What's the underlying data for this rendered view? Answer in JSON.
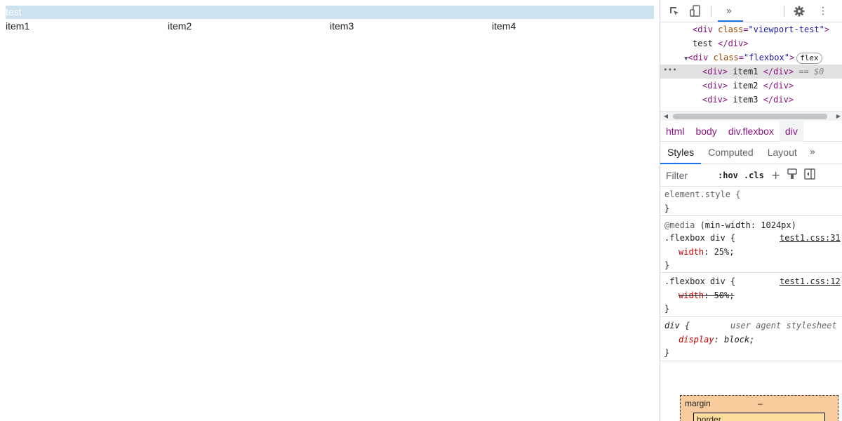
{
  "page": {
    "viewport_test_text": "test",
    "flex_items": [
      "item1",
      "item2",
      "item3",
      "item4"
    ]
  },
  "devtools": {
    "toolbar": {
      "icons": [
        "inspect-icon",
        "device-toggle-icon",
        "more-panels-icon",
        "settings-icon",
        "kebab-menu-icon"
      ]
    },
    "dom": {
      "line1": {
        "tag_open": "<div",
        "attr_name": "class",
        "attr_val": "\"viewport-test\"",
        "tag_close": ">"
      },
      "line2": {
        "text": "test ",
        "tag_end": "</div>"
      },
      "line3": {
        "tag_open": "<div",
        "attr_name": "class",
        "attr_val": "\"flexbox\"",
        "tag_close": ">",
        "badge": "flex"
      },
      "line4": {
        "tag_open": "<div>",
        "text": " item1 ",
        "tag_end": "</div>",
        "suffix": " == $0"
      },
      "line5": {
        "tag_open": "<div>",
        "text": " item2 ",
        "tag_end": "</div>"
      },
      "line6": {
        "tag_open": "<div>",
        "text": " item3 ",
        "tag_end": "</div>"
      }
    },
    "breadcrumb": [
      "html",
      "body",
      "div.flexbox",
      "div"
    ],
    "tabs": [
      "Styles",
      "Computed",
      "Layout"
    ],
    "filter": {
      "placeholder": "Filter",
      "hov": ":hov",
      "cls": ".cls"
    },
    "styles": {
      "element_style": {
        "selector": "element.style {",
        "close": "}"
      },
      "media_rule": {
        "media_keyword": "@media",
        "media_query": " (min-width: 1024px)",
        "selector": ".flexbox div {",
        "source": "test1.css:31",
        "prop": "width",
        "value": "25%;",
        "close": "}"
      },
      "base_rule": {
        "selector": ".flexbox div {",
        "source": "test1.css:12",
        "prop": "width",
        "value": "50%;",
        "close": "}"
      },
      "ua_rule": {
        "selector": "div {",
        "source": "user agent stylesheet",
        "prop": "display",
        "value": "block;",
        "close": "}"
      }
    },
    "box_model": {
      "margin_label": "margin",
      "margin_value": "–",
      "border_label": "border"
    }
  },
  "colors": {
    "viewport_test_bg": "#cce3ef",
    "selection": "#e1e1e1",
    "accent": "#1a73e8",
    "margin_box": "#f9cc9d",
    "border_box": "#fddd9b"
  }
}
